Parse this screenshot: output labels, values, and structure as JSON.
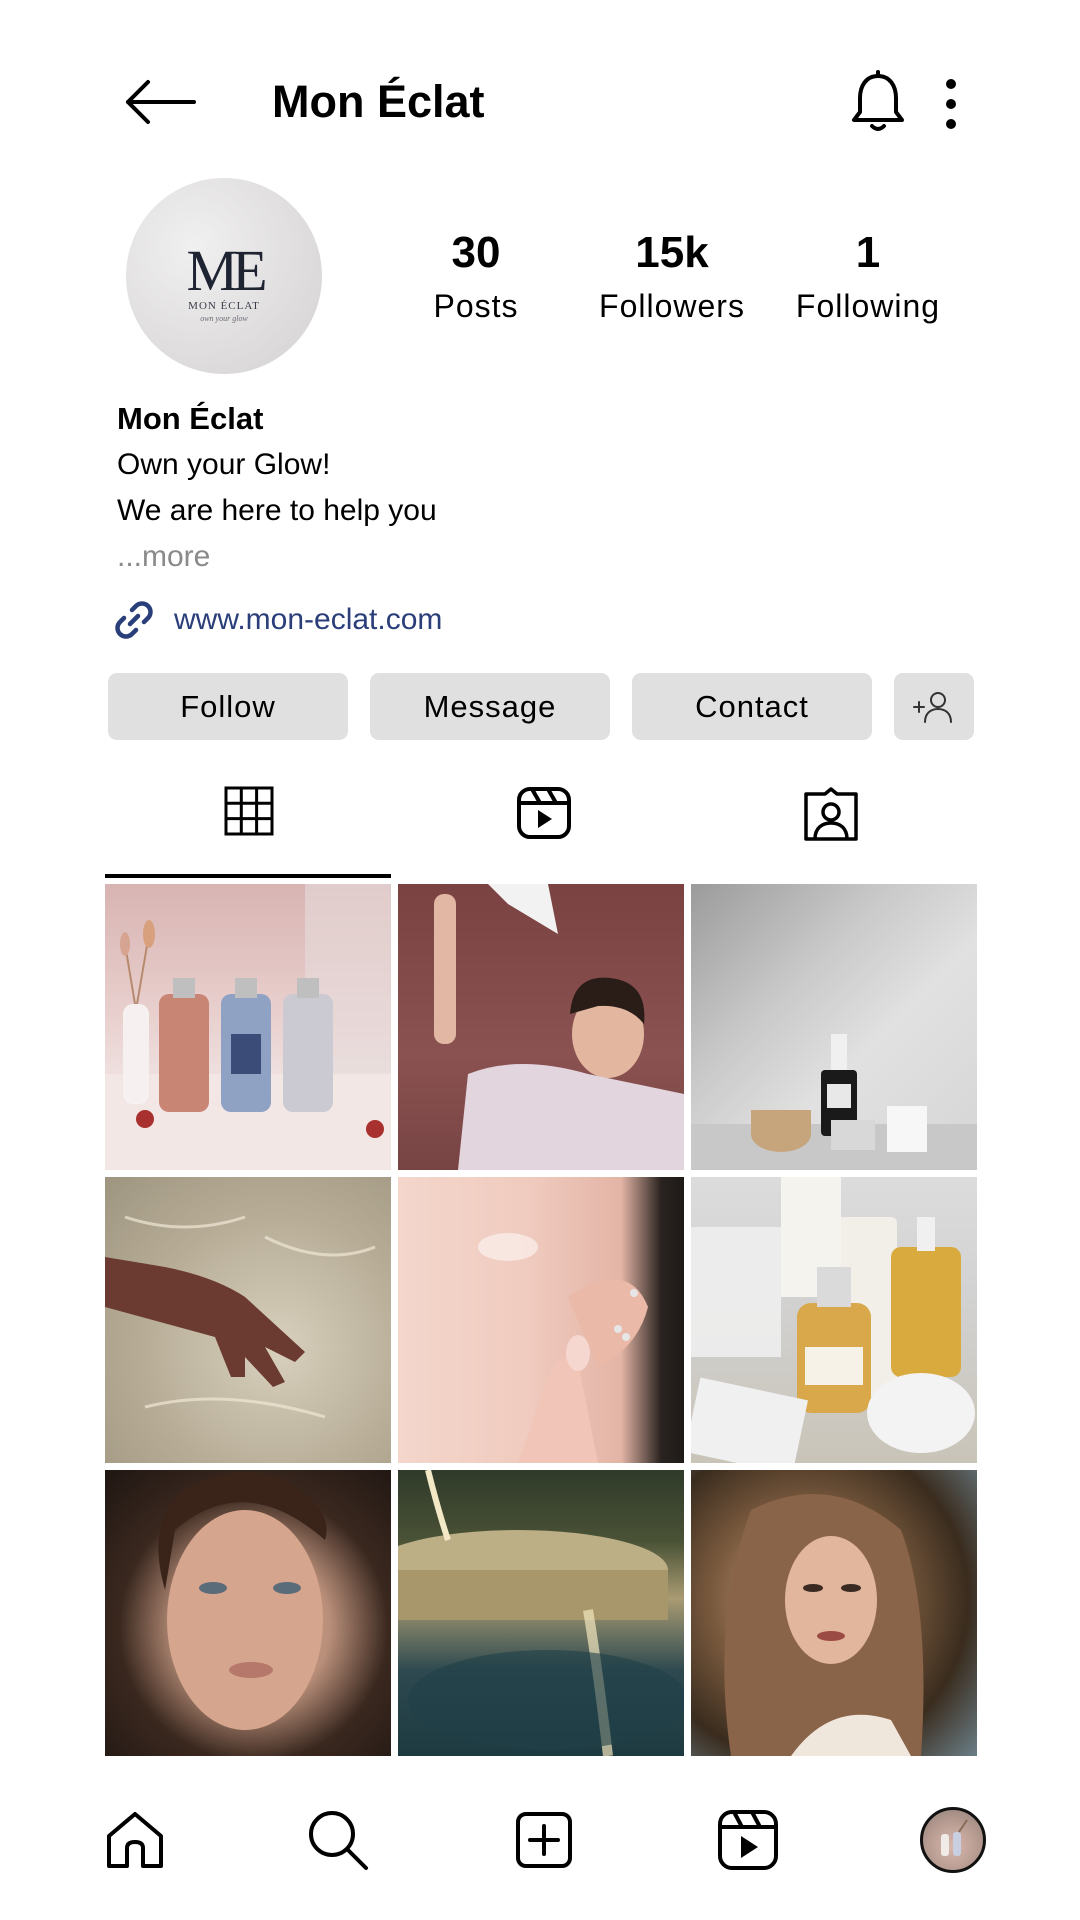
{
  "header": {
    "title": "Mon Éclat",
    "back_icon": "arrow-left-icon",
    "notifications_icon": "bell-icon",
    "menu_icon": "more-vertical-icon"
  },
  "profile": {
    "avatar": {
      "logo_monogram": "ME",
      "logo_name": "MON ÉCLAT",
      "logo_tagline": "own your glow"
    },
    "stats": {
      "posts": {
        "value": "30",
        "label": "Posts"
      },
      "followers": {
        "value": "15k",
        "label": "Followers"
      },
      "following": {
        "value": "1",
        "label": "Following"
      }
    },
    "bio": {
      "name": "Mon Éclat",
      "line1": "Own your Glow!",
      "line2": "We are here to help you",
      "more": "...more"
    },
    "link": {
      "icon": "link-icon",
      "text": "www.mon-eclat.com"
    }
  },
  "actions": {
    "follow": "Follow",
    "message": "Message",
    "contact": "Contact",
    "add_user_icon": "add-person-icon"
  },
  "tabs": {
    "active": "grid",
    "items": [
      "grid-icon",
      "reels-icon",
      "tagged-icon"
    ]
  },
  "bottom_nav": {
    "items": [
      "home-icon",
      "search-icon",
      "create-icon",
      "reels-icon",
      "profile-avatar"
    ]
  },
  "colors": {
    "link": "#2a3e7a",
    "button_bg": "#e0e0e0",
    "muted_text": "#8a8a8a"
  }
}
